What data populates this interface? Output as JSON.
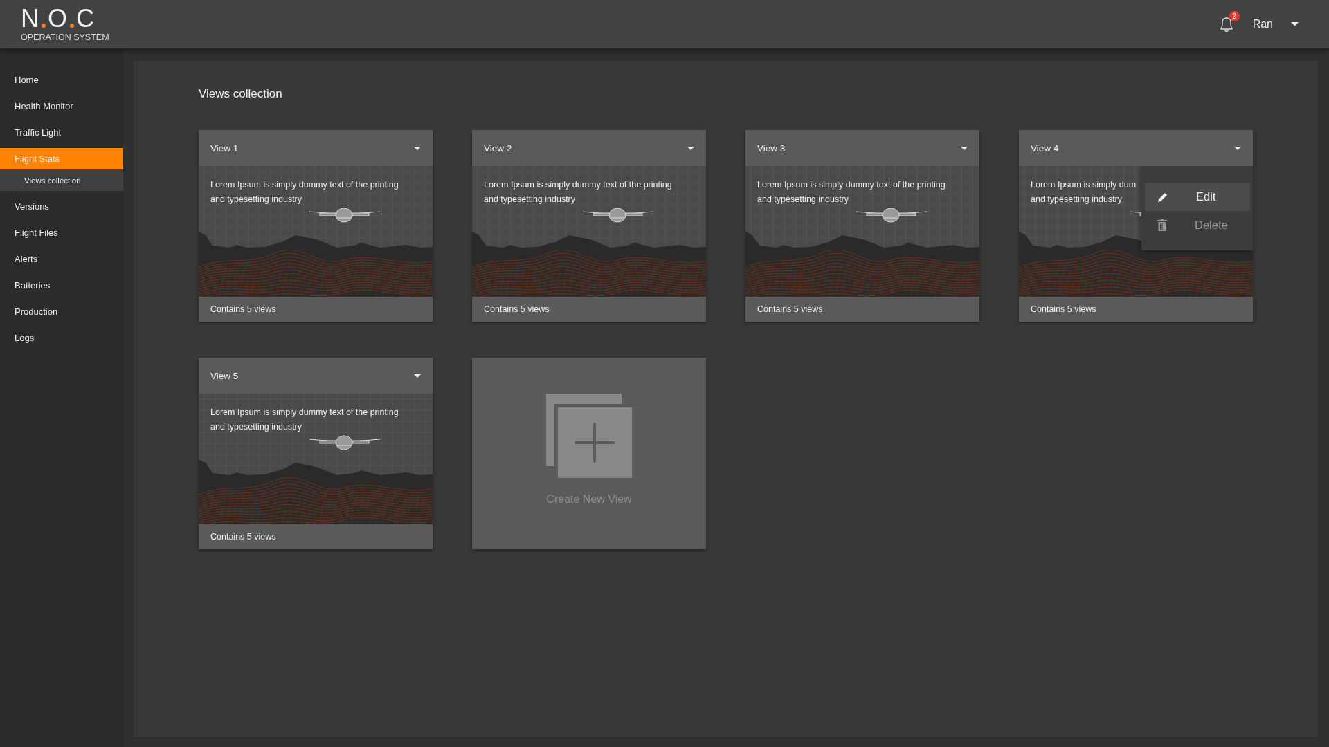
{
  "logo": {
    "letters": [
      "N",
      "O",
      "C"
    ],
    "subtitle": "OPERATION SYSTEM"
  },
  "header": {
    "notifications": "2",
    "user": "Ran"
  },
  "sidebar": {
    "items": [
      {
        "label": "Home",
        "selected": false
      },
      {
        "label": "Health Monitor",
        "selected": false
      },
      {
        "label": "Traffic Light",
        "selected": false
      },
      {
        "label": "Flight Stats",
        "selected": true,
        "expanded": true,
        "children": [
          {
            "label": "Views collection",
            "selected": true
          }
        ]
      },
      {
        "label": "Versions",
        "selected": false
      },
      {
        "label": "Flight Files",
        "selected": false
      },
      {
        "label": "Alerts",
        "selected": false
      },
      {
        "label": "Batteries",
        "selected": false
      },
      {
        "label": "Production",
        "selected": false
      },
      {
        "label": "Logs",
        "selected": false
      }
    ]
  },
  "main": {
    "title": "Views collection",
    "cards": [
      {
        "title": "View 1",
        "description": [
          "Lorem Ipsum is simply dummy text of the printing",
          "and typesetting industry"
        ],
        "footer": "Contains 5 views"
      },
      {
        "title": "View 2",
        "description": [
          "Lorem Ipsum is simply dummy text of the printing",
          "and typesetting industry"
        ],
        "footer": "Contains 5 views"
      },
      {
        "title": "View 3",
        "description": [
          "Lorem Ipsum is simply dummy text of the printing",
          "and typesetting industry"
        ],
        "footer": "Contains 5 views"
      },
      {
        "title": "View 4",
        "description": [
          "Lorem Ipsum is simply dum",
          "and typesetting industry"
        ],
        "footer": "Contains 5 views",
        "menu": {
          "items": [
            {
              "kind": "edit",
              "label": "Edit",
              "selected": true
            },
            {
              "kind": "delete",
              "label": "Delete",
              "selected": false
            }
          ]
        }
      },
      {
        "title": "View 5",
        "description": [
          "Lorem Ipsum is simply dummy text of the printing",
          "and typesetting industry"
        ],
        "footer": "Contains 5 views"
      }
    ],
    "create": {
      "label": "Create New View"
    }
  }
}
